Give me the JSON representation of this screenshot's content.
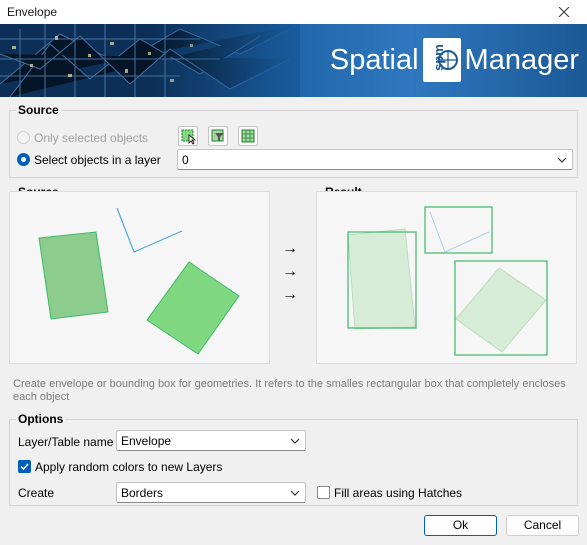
{
  "window": {
    "title": "Envelope",
    "close_icon": "close-icon"
  },
  "banner": {
    "brand_left": "Spatial",
    "brand_logo": "spm",
    "brand_right": "Manager"
  },
  "source_group": {
    "title": "Source",
    "only_selected_label": "Only selected objects",
    "select_in_layer_label": "Select objects in a layer",
    "layer_value": "0",
    "mode_selected": "layer",
    "tool_icons": [
      "select-objects-icon",
      "select-filter-icon",
      "select-table-icon"
    ]
  },
  "preview": {
    "source_title": "Source",
    "result_title": "Result",
    "arrows": [
      "→",
      "→",
      "→"
    ]
  },
  "description": "Create envelope or bounding box for geometries. It refers to the smalles rectangular box that completely encloses each object",
  "options_group": {
    "title": "Options",
    "layer_name_label": "Layer/Table name",
    "layer_name_value": "Envelope",
    "random_colors_label": "Apply random colors to new Layers",
    "random_colors_checked": true,
    "create_label": "Create",
    "create_value": "Borders",
    "fill_hatches_label": "Fill areas using Hatches",
    "fill_hatches_checked": false
  },
  "buttons": {
    "ok": "Ok",
    "cancel": "Cancel"
  },
  "colors": {
    "accent": "#005fb8",
    "shape_dark": "#8ccc8c",
    "shape_bright": "#7fd87f",
    "shape_stroke": "#3cb86a",
    "line": "#4fa8e0"
  }
}
